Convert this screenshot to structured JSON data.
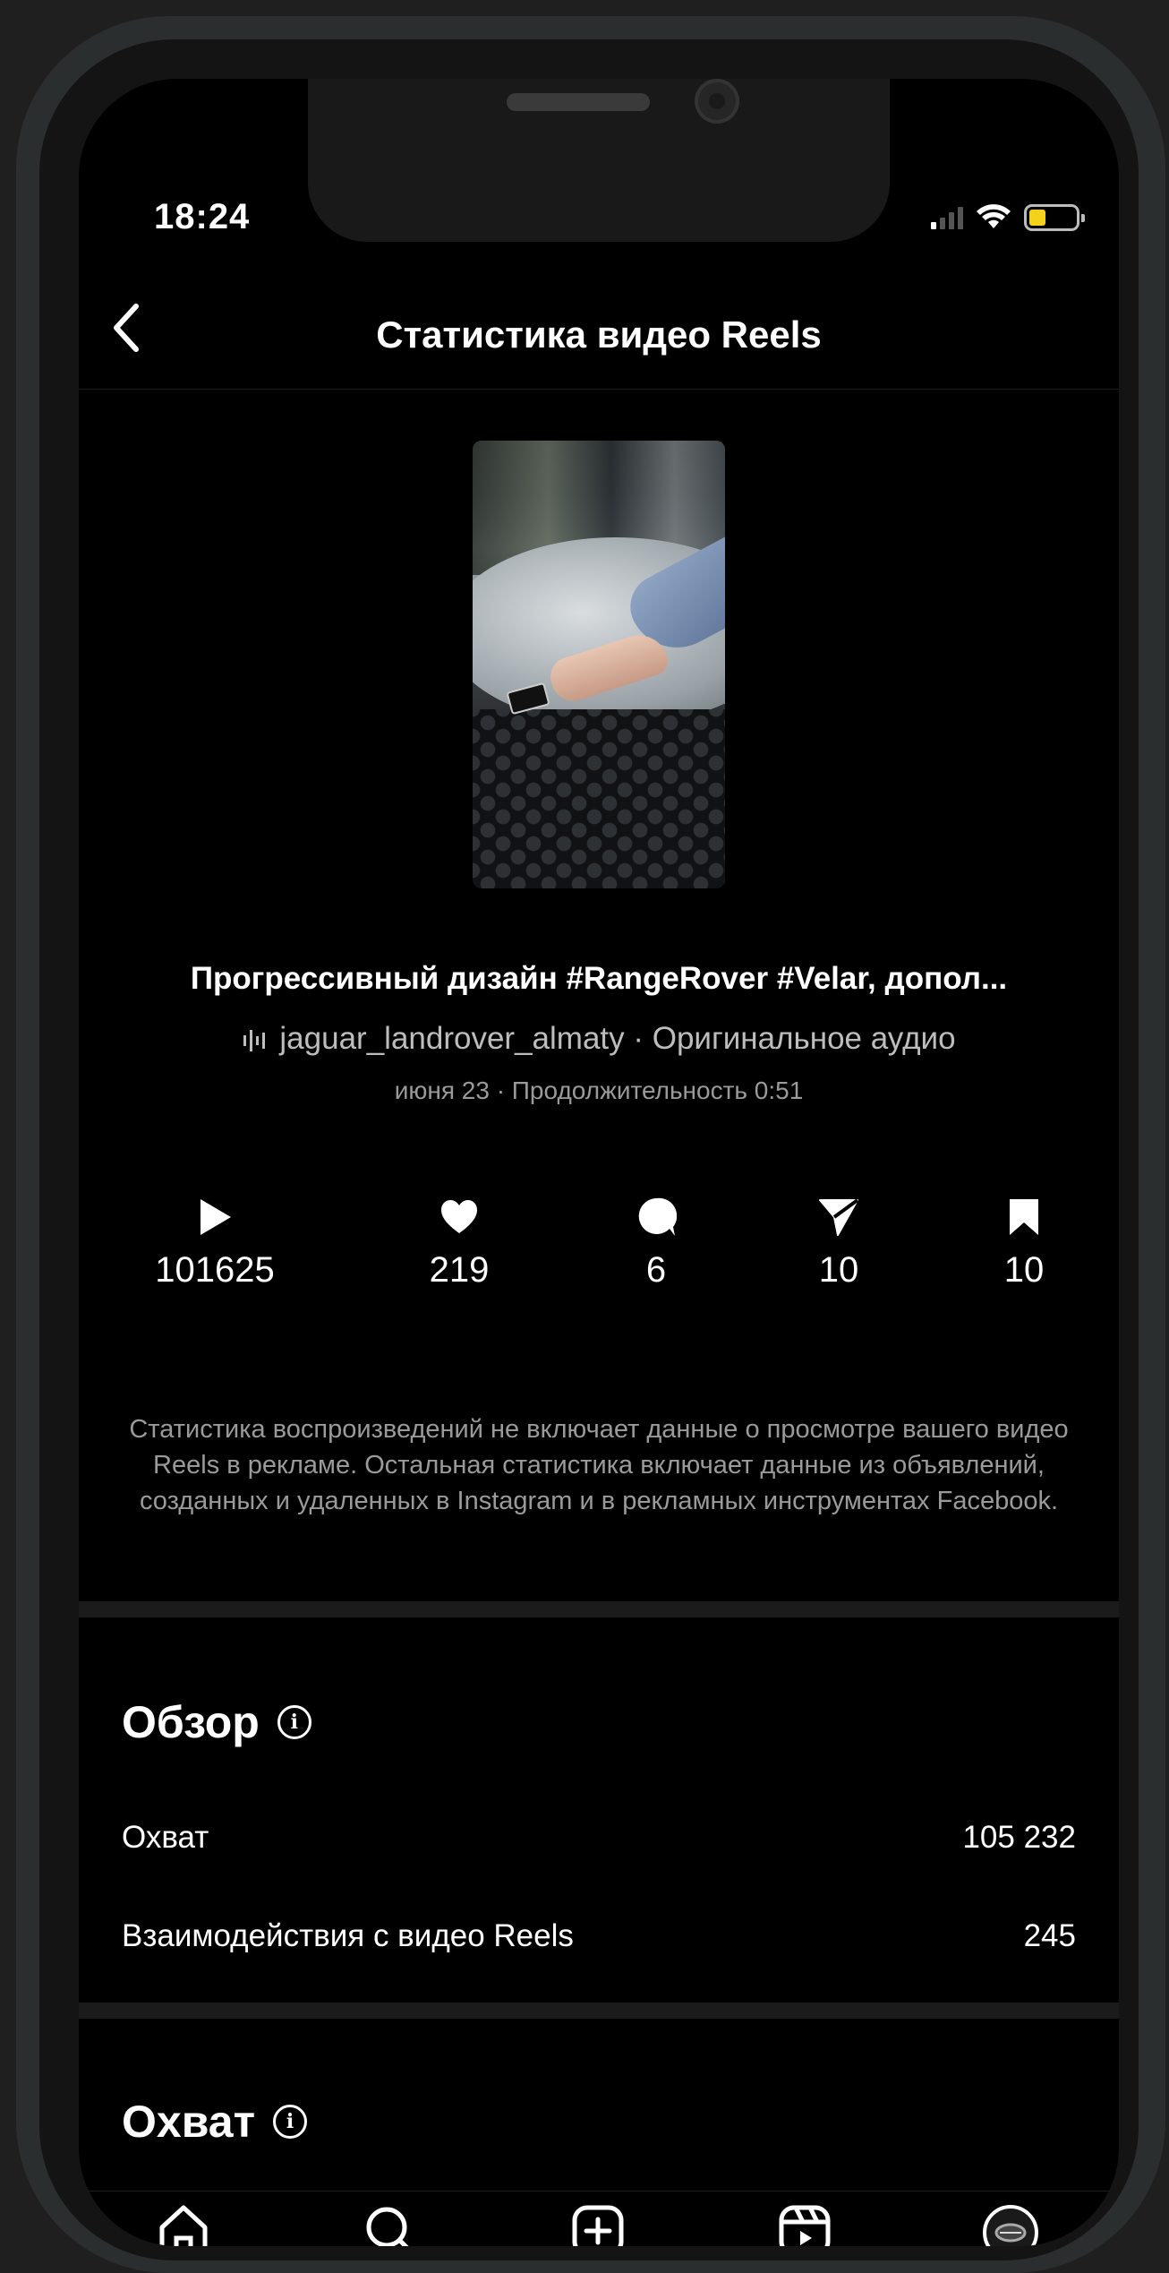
{
  "status_bar": {
    "time": "18:24"
  },
  "header": {
    "title": "Статистика видео Reels"
  },
  "reel": {
    "caption": "Прогрессивный дизайн #RangeRover #Velar, допол...",
    "audio": "jaguar_landrover_almaty · Оригинальное аудио",
    "meta": "июня 23 · Продолжительность 0:51"
  },
  "stats": [
    {
      "icon": "play-icon",
      "value": "101625"
    },
    {
      "icon": "heart-icon",
      "value": "219"
    },
    {
      "icon": "comment-icon",
      "value": "6"
    },
    {
      "icon": "share-icon",
      "value": "10"
    },
    {
      "icon": "bookmark-icon",
      "value": "10"
    }
  ],
  "disclaimer": "Статистика воспроизведений не включает данные о просмотре вашего видео Reels в рекламе. Остальная статистика включает данные из объявлений, созданных и удаленных в Instagram и в рекламных инструментах Facebook.",
  "overview": {
    "title": "Обзор",
    "rows": [
      {
        "label": "Охват",
        "value": "105 232"
      },
      {
        "label": "Взаимодействия с видео Reels",
        "value": "245"
      }
    ]
  },
  "reach": {
    "title": "Охват"
  },
  "tabbar": [
    "home-icon",
    "search-icon",
    "create-icon",
    "reels-icon",
    "profile-avatar"
  ],
  "colors": {
    "background": "#000000",
    "frame": "#2b2e2f",
    "battery": "#f4d21c",
    "secondary_text": "#9a9a9a"
  }
}
